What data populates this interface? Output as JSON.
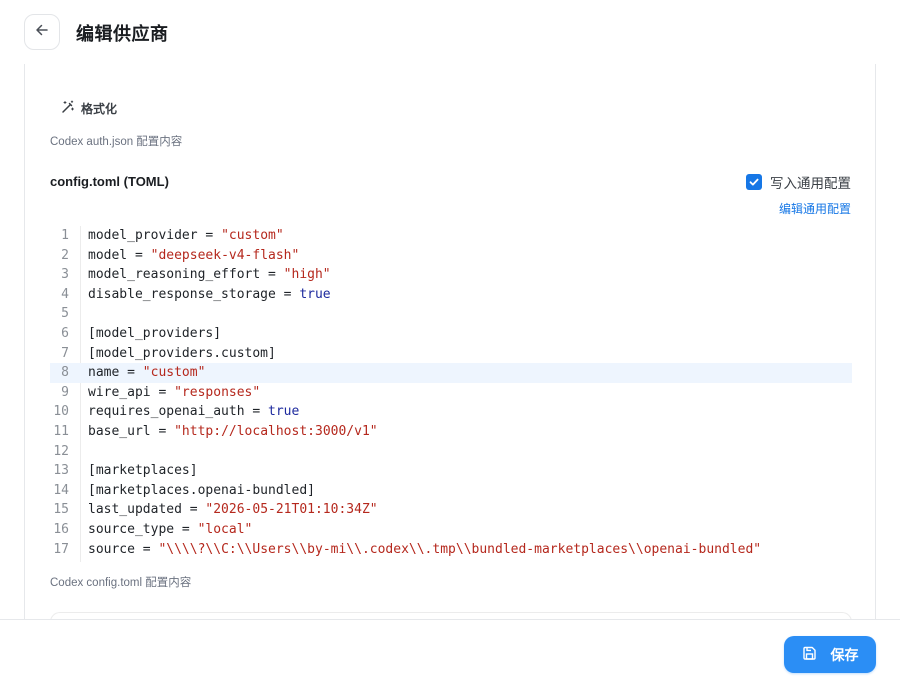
{
  "header": {
    "title": "编辑供应商",
    "back_icon": "arrow-left-icon"
  },
  "panel": {
    "format_label": "格式化",
    "format_icon": "magic-wand-icon",
    "auth_hint": "Codex auth.json 配置内容",
    "config_title": "config.toml (TOML)",
    "write_common_label": "写入通用配置",
    "write_common_checked": true,
    "edit_common_label": "编辑通用配置",
    "config_hint": "Codex config.toml 配置内容"
  },
  "editor": {
    "active_line": 8,
    "lines": [
      {
        "n": "1",
        "tokens": [
          {
            "t": "key",
            "v": "model_provider"
          },
          {
            "t": "op",
            "v": " = "
          },
          {
            "t": "str",
            "v": "\"custom\""
          }
        ]
      },
      {
        "n": "2",
        "tokens": [
          {
            "t": "key",
            "v": "model"
          },
          {
            "t": "op",
            "v": " = "
          },
          {
            "t": "str",
            "v": "\"deepseek-v4-flash\""
          }
        ]
      },
      {
        "n": "3",
        "tokens": [
          {
            "t": "key",
            "v": "model_reasoning_effort"
          },
          {
            "t": "op",
            "v": " = "
          },
          {
            "t": "str",
            "v": "\"high\""
          }
        ]
      },
      {
        "n": "4",
        "tokens": [
          {
            "t": "key",
            "v": "disable_response_storage"
          },
          {
            "t": "op",
            "v": " = "
          },
          {
            "t": "bool",
            "v": "true"
          }
        ]
      },
      {
        "n": "5",
        "tokens": []
      },
      {
        "n": "6",
        "tokens": [
          {
            "t": "sec",
            "v": "[model_providers]"
          }
        ]
      },
      {
        "n": "7",
        "tokens": [
          {
            "t": "sec",
            "v": "[model_providers.custom]"
          }
        ]
      },
      {
        "n": "8",
        "tokens": [
          {
            "t": "key",
            "v": "name"
          },
          {
            "t": "op",
            "v": " = "
          },
          {
            "t": "str",
            "v": "\"custom\""
          }
        ]
      },
      {
        "n": "9",
        "tokens": [
          {
            "t": "key",
            "v": "wire_api"
          },
          {
            "t": "op",
            "v": " = "
          },
          {
            "t": "str",
            "v": "\"responses\""
          }
        ]
      },
      {
        "n": "10",
        "tokens": [
          {
            "t": "key",
            "v": "requires_openai_auth"
          },
          {
            "t": "op",
            "v": " = "
          },
          {
            "t": "bool",
            "v": "true"
          }
        ]
      },
      {
        "n": "11",
        "tokens": [
          {
            "t": "key",
            "v": "base_url"
          },
          {
            "t": "op",
            "v": " = "
          },
          {
            "t": "str",
            "v": "\"http://localhost:3000/v1\""
          }
        ]
      },
      {
        "n": "12",
        "tokens": []
      },
      {
        "n": "13",
        "tokens": [
          {
            "t": "sec",
            "v": "[marketplaces]"
          }
        ]
      },
      {
        "n": "14",
        "tokens": [
          {
            "t": "sec",
            "v": "[marketplaces.openai-bundled]"
          }
        ]
      },
      {
        "n": "15",
        "tokens": [
          {
            "t": "key",
            "v": "last_updated"
          },
          {
            "t": "op",
            "v": " = "
          },
          {
            "t": "str",
            "v": "\"2026-05-21T01:10:34Z\""
          }
        ]
      },
      {
        "n": "16",
        "tokens": [
          {
            "t": "key",
            "v": "source_type"
          },
          {
            "t": "op",
            "v": " = "
          },
          {
            "t": "str",
            "v": "\"local\""
          }
        ]
      },
      {
        "n": "17",
        "tokens": [
          {
            "t": "key",
            "v": "source"
          },
          {
            "t": "op",
            "v": " = "
          },
          {
            "t": "str",
            "v": "\"\\\\\\\\?\\\\C:\\\\Users\\\\by-mi\\\\.codex\\\\.tmp\\\\bundled-marketplaces\\\\openai-bundled\""
          }
        ]
      }
    ]
  },
  "footer": {
    "save_label": "保存",
    "save_icon": "floppy-disk-icon"
  },
  "colors": {
    "accent": "#2b8ef5",
    "link": "#1677e6",
    "string": "#b5281d",
    "boolean": "#1d2a9e",
    "active_line": "#eef5fe"
  }
}
